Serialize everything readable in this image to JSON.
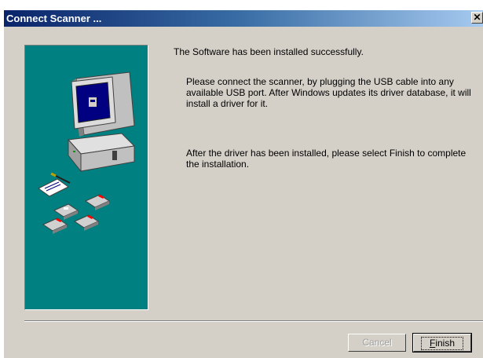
{
  "window": {
    "title": "Connect Scanner ..."
  },
  "titlebar": {
    "close_glyph": "✕"
  },
  "content": {
    "headline": "The Software has been installed successfully.",
    "paragraph1": "Please connect the scanner, by plugging the USB cable into any available USB port. After Windows updates its driver database, it will install a driver for it.",
    "paragraph2": "After the driver has been installed, please select Finish to complete the installation."
  },
  "buttons": {
    "cancel_label": "Cancel",
    "cancel_disabled": true,
    "finish_label": "Finish",
    "finish_mnemonic": "F"
  },
  "colors": {
    "panel_bg": "#008080",
    "dialog_bg": "#d4d0c8",
    "titlebar_start": "#0a246a",
    "titlebar_end": "#a6caf0"
  },
  "icons": {
    "illustration": "computer-with-disks-illustration"
  }
}
